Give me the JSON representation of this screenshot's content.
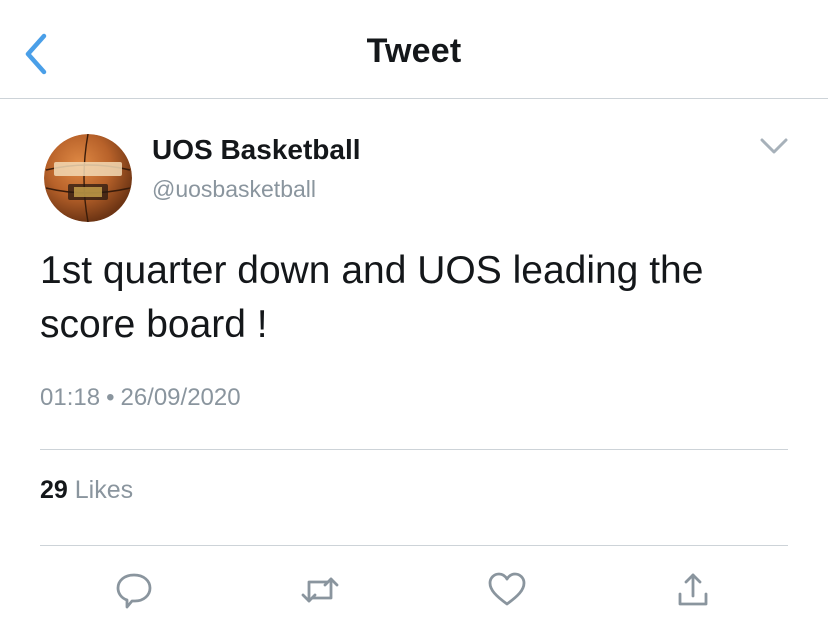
{
  "header": {
    "title": "Tweet",
    "back_icon": "chevron-left-icon",
    "accent_color": "#4a9fe8"
  },
  "tweet": {
    "author": {
      "display_name": "UOS Basketball",
      "handle": "@uosbasketball",
      "avatar": "basketball-avatar"
    },
    "text": "1st quarter down and UOS leading the score board !",
    "time": "01:18",
    "separator": "•",
    "date": "26/09/2020",
    "likes": {
      "count": "29",
      "label": "Likes"
    }
  },
  "actions": [
    {
      "name": "reply",
      "icon": "reply-icon"
    },
    {
      "name": "retweet",
      "icon": "retweet-icon"
    },
    {
      "name": "like",
      "icon": "heart-icon"
    },
    {
      "name": "share",
      "icon": "share-icon"
    }
  ]
}
